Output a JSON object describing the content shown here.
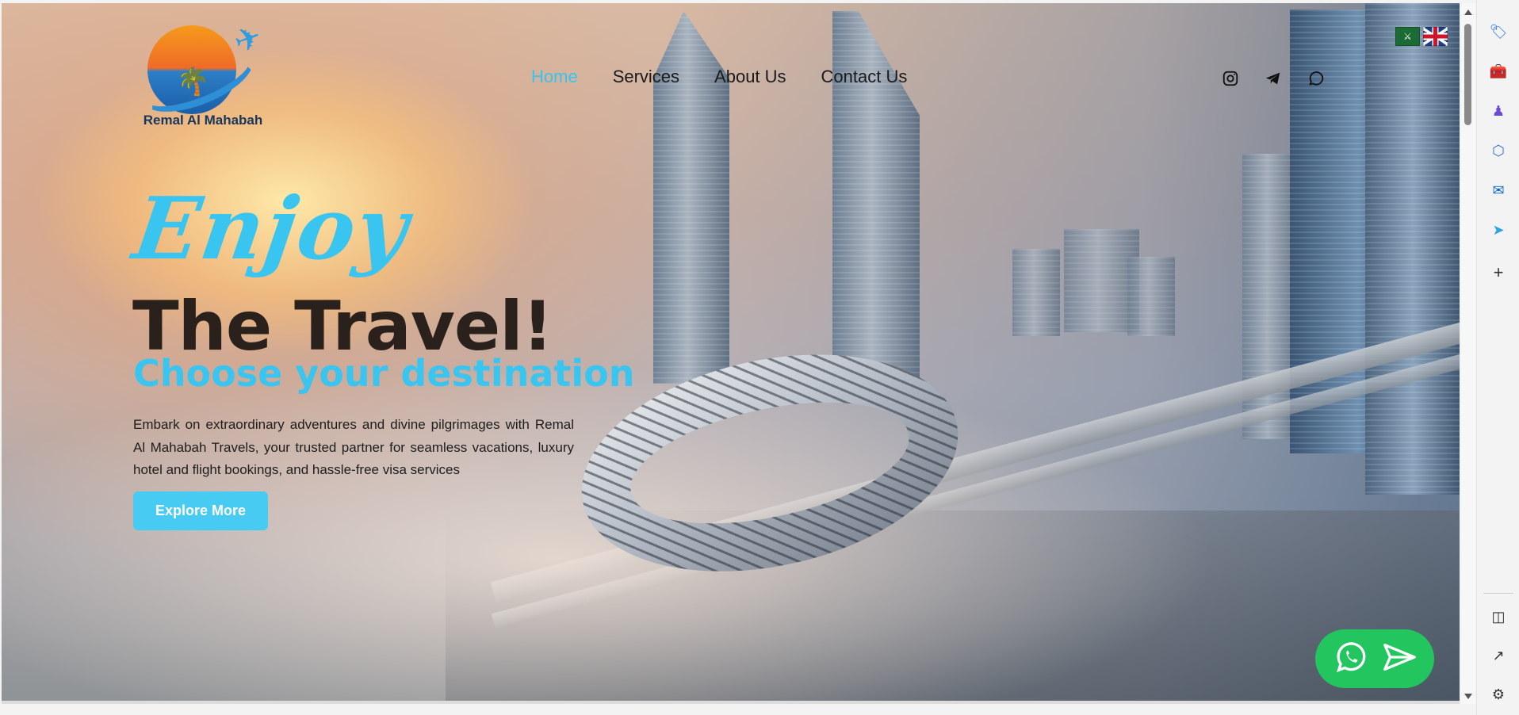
{
  "brand": {
    "name": "Remal Al Mahabah"
  },
  "nav": {
    "items": [
      {
        "label": "Home",
        "active": true
      },
      {
        "label": "Services",
        "active": false
      },
      {
        "label": "About Us",
        "active": false
      },
      {
        "label": "Contact Us",
        "active": false
      }
    ]
  },
  "social": [
    "instagram-icon",
    "telegram-icon",
    "whatsapp-icon"
  ],
  "languages": [
    "arabic",
    "english"
  ],
  "hero": {
    "script_word": "Enjoy",
    "headline": "The Travel!",
    "subheadline": "Choose your destination",
    "description": "Embark on extraordinary adventures and divine pilgrimages with Remal Al Mahabah Travels, your trusted partner for seamless vacations, luxury hotel and flight bookings, and hassle-free visa services",
    "cta_label": "Explore More"
  },
  "floating_contact": [
    "whatsapp-icon",
    "send-icon"
  ],
  "colors": {
    "accent": "#39c5f0",
    "headline": "#2a211c",
    "whatsapp": "#22c55e"
  },
  "browser_sidebar": {
    "icons": [
      "tag-icon",
      "toolbox-icon",
      "people-icon",
      "copilot-icon",
      "outlook-icon",
      "send-icon",
      "add-icon",
      "split-screen-icon",
      "open-external-icon",
      "settings-icon"
    ]
  }
}
